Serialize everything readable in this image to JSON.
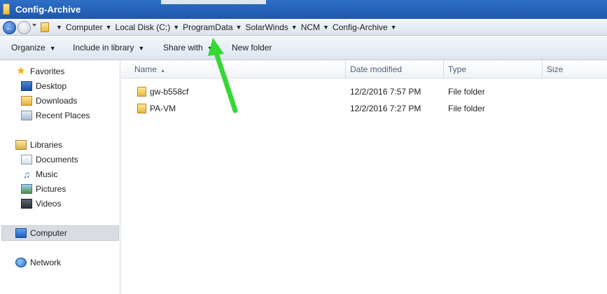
{
  "window": {
    "title": "Config-Archive"
  },
  "address": {
    "crumbs": [
      "Computer",
      "Local Disk (C:)",
      "ProgramData",
      "SolarWinds",
      "NCM",
      "Config-Archive"
    ]
  },
  "toolbar": {
    "organize": "Organize",
    "include_in_library": "Include in library",
    "share_with": "Share with",
    "new_folder": "New folder"
  },
  "nav": {
    "favorites": "Favorites",
    "desktop": "Desktop",
    "downloads": "Downloads",
    "recent_places": "Recent Places",
    "libraries": "Libraries",
    "documents": "Documents",
    "music": "Music",
    "pictures": "Pictures",
    "videos": "Videos",
    "computer": "Computer",
    "network": "Network"
  },
  "columns": {
    "name": "Name",
    "date_modified": "Date modified",
    "type": "Type",
    "size": "Size"
  },
  "files": [
    {
      "name": "gw-b558cf",
      "date": "12/2/2016 7:57 PM",
      "type": "File folder"
    },
    {
      "name": "PA-VM",
      "date": "12/2/2016 7:27 PM",
      "type": "File folder"
    }
  ],
  "colors": {
    "annotation_arrow": "#35d835",
    "titlebar": "#2462bd"
  }
}
